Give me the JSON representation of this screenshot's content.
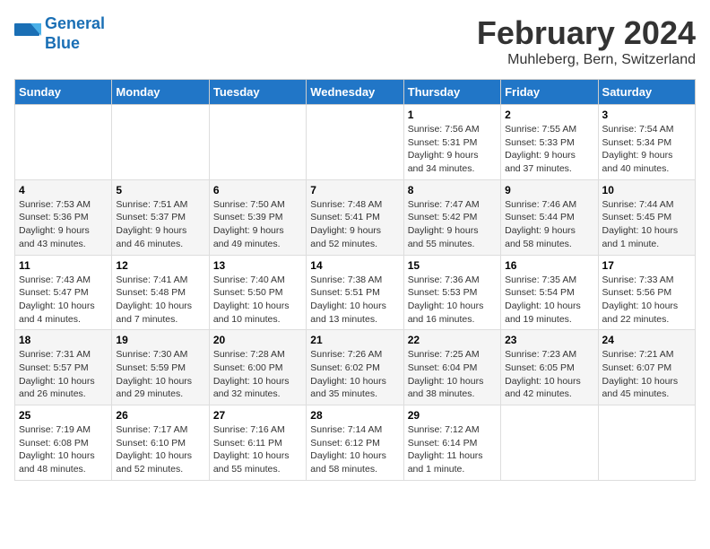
{
  "header": {
    "logo_line1": "General",
    "logo_line2": "Blue",
    "title": "February 2024",
    "subtitle": "Muhleberg, Bern, Switzerland"
  },
  "days_of_week": [
    "Sunday",
    "Monday",
    "Tuesday",
    "Wednesday",
    "Thursday",
    "Friday",
    "Saturday"
  ],
  "weeks": [
    [
      {
        "day": "",
        "info": ""
      },
      {
        "day": "",
        "info": ""
      },
      {
        "day": "",
        "info": ""
      },
      {
        "day": "",
        "info": ""
      },
      {
        "day": "1",
        "info": "Sunrise: 7:56 AM\nSunset: 5:31 PM\nDaylight: 9 hours\nand 34 minutes."
      },
      {
        "day": "2",
        "info": "Sunrise: 7:55 AM\nSunset: 5:33 PM\nDaylight: 9 hours\nand 37 minutes."
      },
      {
        "day": "3",
        "info": "Sunrise: 7:54 AM\nSunset: 5:34 PM\nDaylight: 9 hours\nand 40 minutes."
      }
    ],
    [
      {
        "day": "4",
        "info": "Sunrise: 7:53 AM\nSunset: 5:36 PM\nDaylight: 9 hours\nand 43 minutes."
      },
      {
        "day": "5",
        "info": "Sunrise: 7:51 AM\nSunset: 5:37 PM\nDaylight: 9 hours\nand 46 minutes."
      },
      {
        "day": "6",
        "info": "Sunrise: 7:50 AM\nSunset: 5:39 PM\nDaylight: 9 hours\nand 49 minutes."
      },
      {
        "day": "7",
        "info": "Sunrise: 7:48 AM\nSunset: 5:41 PM\nDaylight: 9 hours\nand 52 minutes."
      },
      {
        "day": "8",
        "info": "Sunrise: 7:47 AM\nSunset: 5:42 PM\nDaylight: 9 hours\nand 55 minutes."
      },
      {
        "day": "9",
        "info": "Sunrise: 7:46 AM\nSunset: 5:44 PM\nDaylight: 9 hours\nand 58 minutes."
      },
      {
        "day": "10",
        "info": "Sunrise: 7:44 AM\nSunset: 5:45 PM\nDaylight: 10 hours\nand 1 minute."
      }
    ],
    [
      {
        "day": "11",
        "info": "Sunrise: 7:43 AM\nSunset: 5:47 PM\nDaylight: 10 hours\nand 4 minutes."
      },
      {
        "day": "12",
        "info": "Sunrise: 7:41 AM\nSunset: 5:48 PM\nDaylight: 10 hours\nand 7 minutes."
      },
      {
        "day": "13",
        "info": "Sunrise: 7:40 AM\nSunset: 5:50 PM\nDaylight: 10 hours\nand 10 minutes."
      },
      {
        "day": "14",
        "info": "Sunrise: 7:38 AM\nSunset: 5:51 PM\nDaylight: 10 hours\nand 13 minutes."
      },
      {
        "day": "15",
        "info": "Sunrise: 7:36 AM\nSunset: 5:53 PM\nDaylight: 10 hours\nand 16 minutes."
      },
      {
        "day": "16",
        "info": "Sunrise: 7:35 AM\nSunset: 5:54 PM\nDaylight: 10 hours\nand 19 minutes."
      },
      {
        "day": "17",
        "info": "Sunrise: 7:33 AM\nSunset: 5:56 PM\nDaylight: 10 hours\nand 22 minutes."
      }
    ],
    [
      {
        "day": "18",
        "info": "Sunrise: 7:31 AM\nSunset: 5:57 PM\nDaylight: 10 hours\nand 26 minutes."
      },
      {
        "day": "19",
        "info": "Sunrise: 7:30 AM\nSunset: 5:59 PM\nDaylight: 10 hours\nand 29 minutes."
      },
      {
        "day": "20",
        "info": "Sunrise: 7:28 AM\nSunset: 6:00 PM\nDaylight: 10 hours\nand 32 minutes."
      },
      {
        "day": "21",
        "info": "Sunrise: 7:26 AM\nSunset: 6:02 PM\nDaylight: 10 hours\nand 35 minutes."
      },
      {
        "day": "22",
        "info": "Sunrise: 7:25 AM\nSunset: 6:04 PM\nDaylight: 10 hours\nand 38 minutes."
      },
      {
        "day": "23",
        "info": "Sunrise: 7:23 AM\nSunset: 6:05 PM\nDaylight: 10 hours\nand 42 minutes."
      },
      {
        "day": "24",
        "info": "Sunrise: 7:21 AM\nSunset: 6:07 PM\nDaylight: 10 hours\nand 45 minutes."
      }
    ],
    [
      {
        "day": "25",
        "info": "Sunrise: 7:19 AM\nSunset: 6:08 PM\nDaylight: 10 hours\nand 48 minutes."
      },
      {
        "day": "26",
        "info": "Sunrise: 7:17 AM\nSunset: 6:10 PM\nDaylight: 10 hours\nand 52 minutes."
      },
      {
        "day": "27",
        "info": "Sunrise: 7:16 AM\nSunset: 6:11 PM\nDaylight: 10 hours\nand 55 minutes."
      },
      {
        "day": "28",
        "info": "Sunrise: 7:14 AM\nSunset: 6:12 PM\nDaylight: 10 hours\nand 58 minutes."
      },
      {
        "day": "29",
        "info": "Sunrise: 7:12 AM\nSunset: 6:14 PM\nDaylight: 11 hours\nand 1 minute."
      },
      {
        "day": "",
        "info": ""
      },
      {
        "day": "",
        "info": ""
      }
    ]
  ]
}
